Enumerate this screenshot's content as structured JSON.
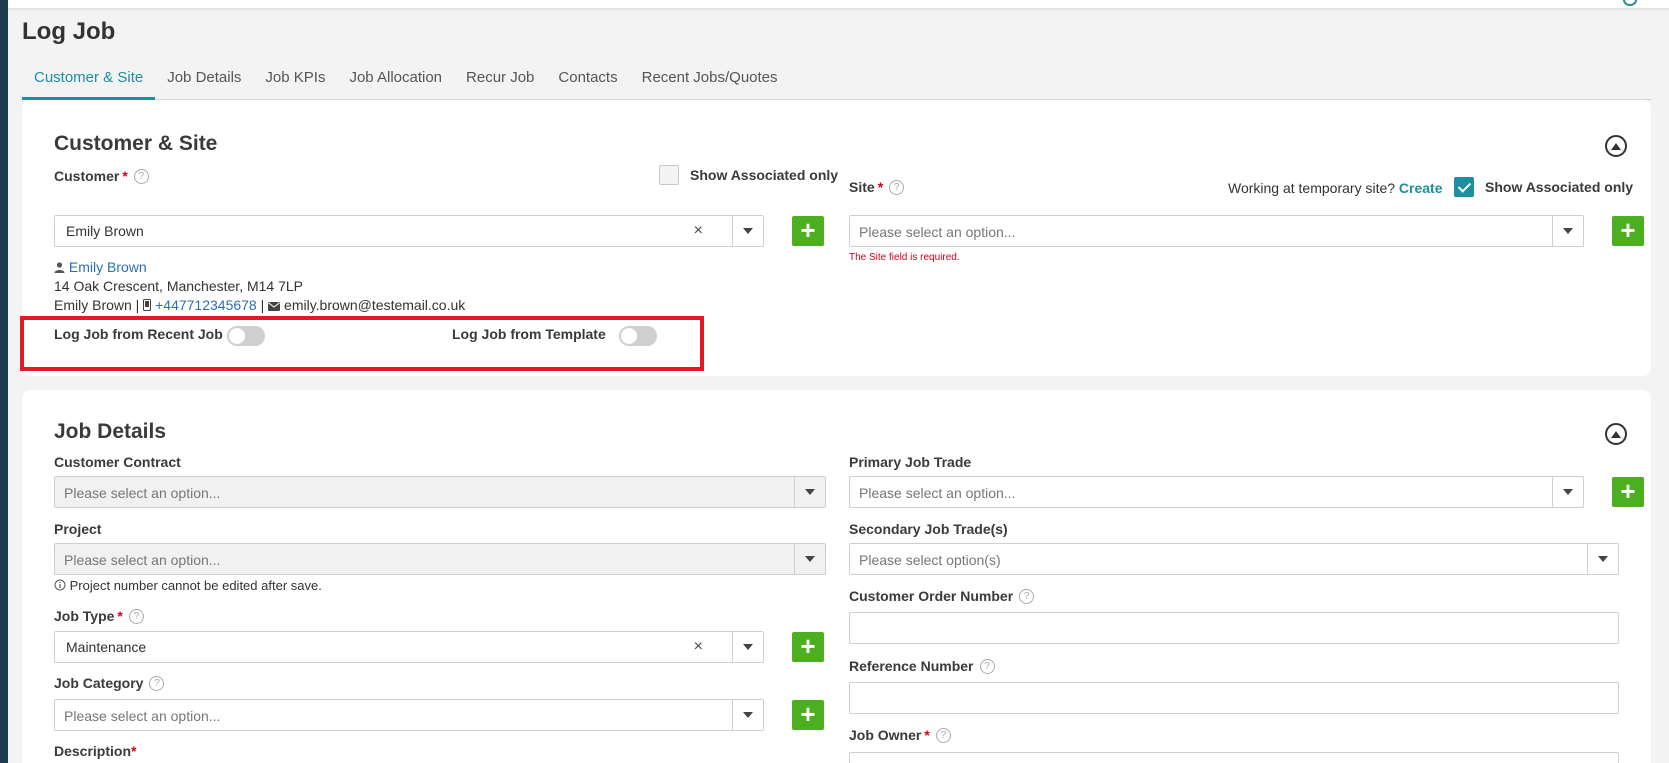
{
  "page_title": "Log Job",
  "tabs": [
    {
      "label": "Customer & Site",
      "active": true
    },
    {
      "label": "Job Details"
    },
    {
      "label": "Job KPIs"
    },
    {
      "label": "Job Allocation"
    },
    {
      "label": "Recur Job"
    },
    {
      "label": "Contacts"
    },
    {
      "label": "Recent Jobs/Quotes"
    }
  ],
  "customer_site": {
    "title": "Customer & Site",
    "customer_label": "Customer",
    "customer_show_assoc_label": "Show Associated only",
    "customer_value": "Emily Brown",
    "customer_name_link": "Emily Brown",
    "address": "14 Oak Crescent, Manchester, M14 7LP",
    "contact_name": "Emily Brown",
    "phone": "+447712345678",
    "email": "emily.brown@testemail.co.uk",
    "log_from_recent_label": "Log Job from Recent Job",
    "log_from_template_label": "Log Job from Template",
    "site_label": "Site",
    "temp_site_text": "Working at temporary site?",
    "temp_site_link": "Create",
    "site_show_assoc_label": "Show Associated only",
    "site_placeholder": "Please select an option...",
    "site_error": "The Site field is required."
  },
  "job_details": {
    "title": "Job Details",
    "customer_contract_label": "Customer Contract",
    "customer_contract_placeholder": "Please select an option...",
    "project_label": "Project",
    "project_placeholder": "Please select an option...",
    "project_note": "Project number cannot be edited after save.",
    "job_type_label": "Job Type",
    "job_type_value": "Maintenance",
    "job_category_label": "Job Category",
    "job_category_placeholder": "Please select an option...",
    "description_label": "Description",
    "primary_trade_label": "Primary Job Trade",
    "primary_trade_placeholder": "Please select an option...",
    "secondary_trade_label": "Secondary Job Trade(s)",
    "secondary_trade_placeholder": "Please select option(s)",
    "order_number_label": "Customer Order Number",
    "reference_label": "Reference Number",
    "job_owner_label": "Job Owner"
  },
  "colors": {
    "accent": "#1d8fa0",
    "add_button": "#4caf1f",
    "error": "#d0021b",
    "highlight": "#e01b24"
  }
}
